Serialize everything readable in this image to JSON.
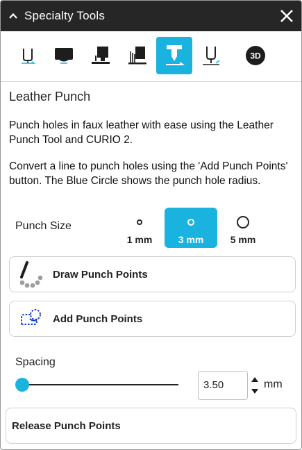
{
  "window": {
    "title": "Specialty Tools"
  },
  "tools": [
    {
      "name": "cutting-blade-tool",
      "active": false
    },
    {
      "name": "fine-point-pen-tool",
      "active": false
    },
    {
      "name": "embossing-tool",
      "active": false
    },
    {
      "name": "stippling-tool",
      "active": false
    },
    {
      "name": "leather-punch-tool",
      "active": true
    },
    {
      "name": "etching-tool",
      "active": false
    },
    {
      "name": "3d-tool",
      "active": false,
      "label": "3D"
    }
  ],
  "panel": {
    "heading": "Leather Punch",
    "description1": "Punch holes in faux leather with ease using the Leather Punch Tool and CURIO 2.",
    "description2": "Convert a line to punch holes using the 'Add Punch Points' button. The Blue Circle shows the punch hole radius."
  },
  "punch_size": {
    "label": "Punch Size",
    "options": [
      {
        "label": "1 mm",
        "selected": false
      },
      {
        "label": "3 mm",
        "selected": true
      },
      {
        "label": "5 mm",
        "selected": false
      }
    ]
  },
  "buttons": {
    "draw": "Draw Punch Points",
    "add": "Add Punch Points",
    "release": "Release Punch Points"
  },
  "spacing": {
    "label": "Spacing",
    "value": "3.50",
    "unit": "mm",
    "slider_fraction": 0.0
  },
  "colors": {
    "accent": "#1ab3e0",
    "titlebar": "#262626"
  }
}
